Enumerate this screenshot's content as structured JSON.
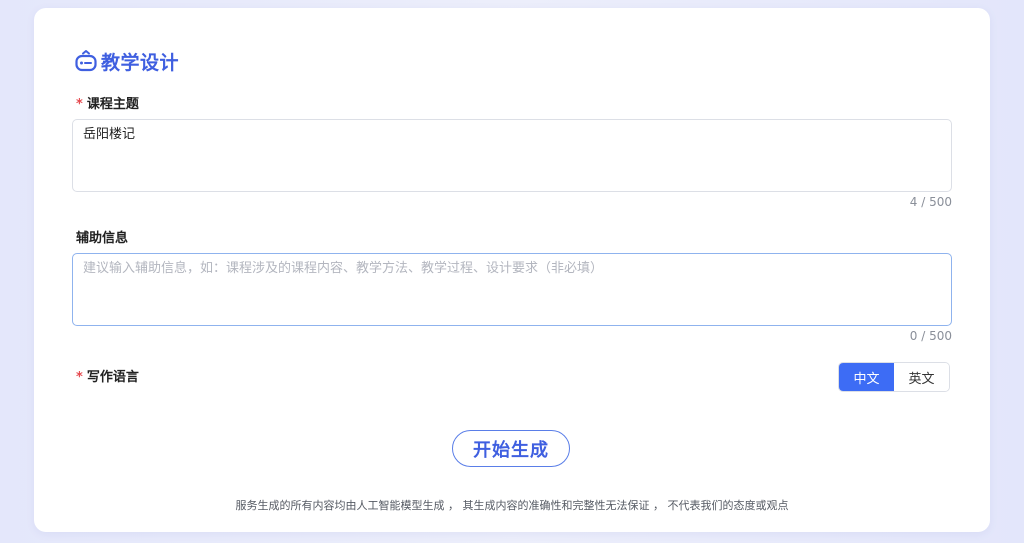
{
  "header": {
    "title": "教学设计",
    "icon": "robot-icon",
    "accent_color": "#3f5fe0"
  },
  "form": {
    "topic": {
      "label": "课程主题",
      "required_mark": "*",
      "value": "岳阳楼记",
      "counter": "4 / 500"
    },
    "aux": {
      "label": "辅助信息",
      "placeholder": "建议输入辅助信息，如：课程涉及的课程内容、教学方法、教学过程、设计要求（非必填）",
      "value": "",
      "counter": "0 / 500"
    },
    "language": {
      "label": "写作语言",
      "required_mark": "*",
      "options": [
        "中文",
        "英文"
      ],
      "selected": "中文",
      "selected_color": "#3d6cf5"
    }
  },
  "actions": {
    "generate_label": "开始生成"
  },
  "footer": {
    "disclaimer": "服务生成的所有内容均由人工智能模型生成 ， 其生成内容的准确性和完整性无法保证 ， 不代表我们的态度或观点"
  }
}
